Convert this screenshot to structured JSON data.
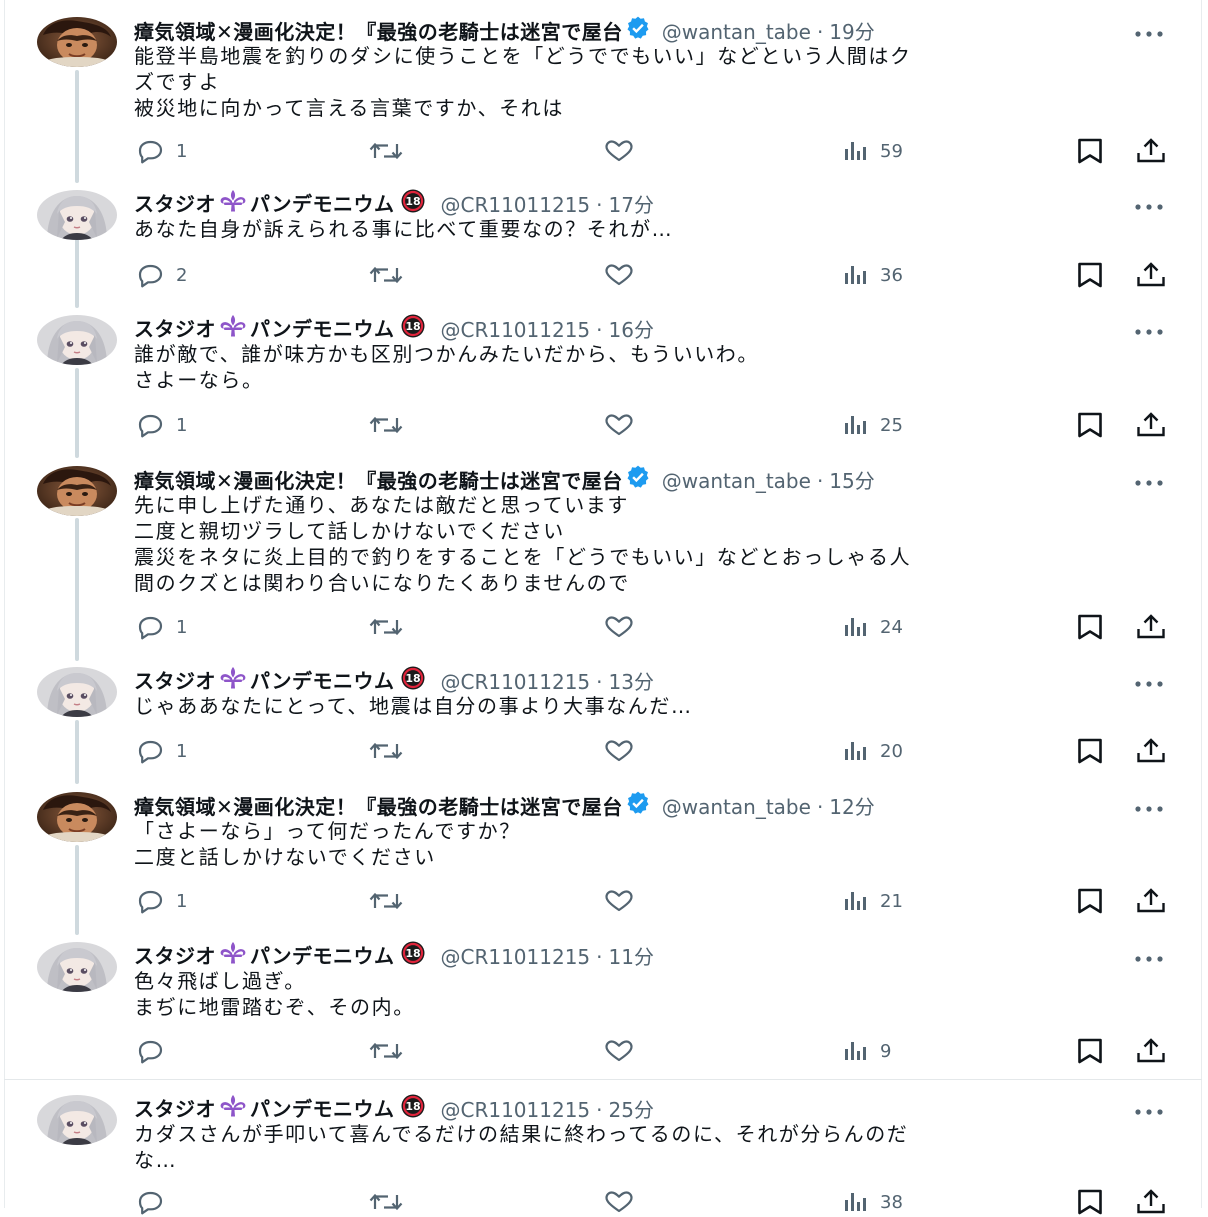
{
  "tweets": [
    {
      "author": "strong",
      "name_text": "瘴気領域✕漫画化決定！『最強の老騎士は迷宮で屋台",
      "handle": "@wantan_tabe",
      "time": "19分",
      "lines": [
        "能登半島地震を釣りのダシに使うことを「どうででもいい」などという人間はク",
        "ズですよ",
        "被災地に向かって言える言葉ですか、それは"
      ],
      "replies": "1",
      "retweets": "",
      "likes": "",
      "views": "59"
    },
    {
      "author": "studio",
      "name_pre": "スタジオ",
      "name_post": "パンデモニウム",
      "handle": "@CR11011215",
      "time": "17分",
      "lines": [
        "あなた自身が訴えられる事に比べて重要なの？それが…"
      ],
      "replies": "2",
      "retweets": "",
      "likes": "",
      "views": "36"
    },
    {
      "author": "studio",
      "name_pre": "スタジオ",
      "name_post": "パンデモニウム",
      "handle": "@CR11011215",
      "time": "16分",
      "lines": [
        "誰が敵で、誰が味方かも区別つかんみたいだから、もういいわ。",
        "さよーなら。"
      ],
      "replies": "1",
      "retweets": "",
      "likes": "",
      "views": "25"
    },
    {
      "author": "strong",
      "name_text": "瘴気領域✕漫画化決定！『最強の老騎士は迷宮で屋台",
      "handle": "@wantan_tabe",
      "time": "15分",
      "lines": [
        "先に申し上げた通り、あなたは敵だと思っています",
        "二度と親切ヅラして話しかけないでください",
        "震災をネタに炎上目的で釣りをすることを「どうでもいい」などとおっしゃる人",
        "間のクズとは関わり合いになりたくありませんので"
      ],
      "replies": "1",
      "retweets": "",
      "likes": "",
      "views": "24"
    },
    {
      "author": "studio",
      "name_pre": "スタジオ",
      "name_post": "パンデモニウム",
      "handle": "@CR11011215",
      "time": "13分",
      "lines": [
        "じゃああなたにとって、地震は自分の事より大事なんだ…"
      ],
      "replies": "1",
      "retweets": "",
      "likes": "",
      "views": "20"
    },
    {
      "author": "strong",
      "name_text": "瘴気領域✕漫画化決定！『最強の老騎士は迷宮で屋台",
      "handle": "@wantan_tabe",
      "time": "12分",
      "lines": [
        "「さよーなら」って何だったんですか？",
        "二度と話しかけないでください"
      ],
      "replies": "1",
      "retweets": "",
      "likes": "",
      "views": "21"
    },
    {
      "author": "studio",
      "name_pre": "スタジオ",
      "name_post": "パンデモニウム",
      "handle": "@CR11011215",
      "time": "11分",
      "lines": [
        "色々飛ばし過ぎ。",
        "まぢに地雷踏むぞ、その内。"
      ],
      "replies": "",
      "retweets": "",
      "likes": "",
      "views": "9"
    },
    {
      "author": "studio",
      "name_pre": "スタジオ",
      "name_post": "パンデモニウム",
      "handle": "@CR11011215",
      "time": "25分",
      "lines": [
        "カダスさんが手叩いて喜んでるだけの結果に終わってるのに、それが分らんのだ",
        "な…"
      ],
      "replies": "",
      "retweets": "",
      "likes": "",
      "views": "38"
    }
  ],
  "age_badge": "18",
  "colors": {
    "text": "#0f1419",
    "secondary": "#536471",
    "verified": "#1d9bf0",
    "thread_line": "#cfd9de",
    "fleur": "#8e55c9"
  },
  "icons": [
    "reply-icon",
    "retweet-icon",
    "like-icon",
    "views-icon",
    "bookmark-icon",
    "share-icon",
    "more-icon",
    "verified-badge-icon",
    "fleur-de-lis-icon",
    "age-18-badge-icon"
  ]
}
